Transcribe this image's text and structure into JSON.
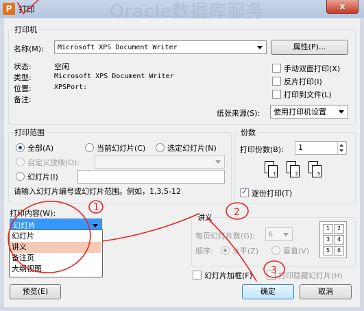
{
  "window": {
    "title": "打印",
    "app_icon_letter": "P",
    "watermark_text": "Oracle数据库服务",
    "close_glyph": "x"
  },
  "printer": {
    "legend": "打印机",
    "name_label": "名称(M):",
    "name_value": "Microsoft XPS Document Writer",
    "properties_button": "属性(P)...",
    "status_label": "状态:",
    "status_value": "空闲",
    "type_label": "类型:",
    "type_value": "Microsoft XPS Document Writer",
    "where_label": "位置:",
    "where_value": "XPSPort:",
    "comment_label": "备注:",
    "manual_duplex": "手动双面打印(X)",
    "reverse_print": "反片打印(I)",
    "print_to_file": "打印到文件(L)",
    "paper_source_label": "纸张来源(S):",
    "paper_source_value": "使用打印机设置"
  },
  "range": {
    "legend": "打印范围",
    "all": "全部(A)",
    "current_slide": "当前幻灯片(C)",
    "selected_slides": "选定幻灯片(N)",
    "custom_show": "自定义放映(O):",
    "slides": "幻灯片(I)",
    "hint": "请输入幻灯片编号或幻灯片范围。例如，1,3,5-12"
  },
  "copies": {
    "legend": "份数",
    "count_label": "打印份数(B):",
    "count_value": "1",
    "page_labels": [
      "1",
      "1",
      "2",
      "2",
      "3",
      "3"
    ],
    "collate": "逐份打印(T)"
  },
  "print_what": {
    "label": "打印内容(W):",
    "value": "幻灯片",
    "options": [
      "幻灯片",
      "讲义",
      "备注页",
      "大纲视图"
    ]
  },
  "handouts": {
    "legend": "讲义",
    "per_page_label": "每页幻灯片数(G):",
    "per_page_value": "6",
    "order_label": "顺序:",
    "horizontal": "水平(Z)",
    "vertical": "垂直(V)",
    "grid_labels": [
      "1",
      "2",
      "3",
      "4",
      "5",
      "6"
    ]
  },
  "options": {
    "frame_slides": "幻灯片加框(F)",
    "print_hidden": "打印隐藏幻灯片(H)"
  },
  "buttons": {
    "preview": "预览(E)",
    "ok": "确定",
    "cancel": "取消"
  },
  "annotations": {
    "marks": [
      "1",
      "2",
      "3"
    ],
    "color": "#e8231c"
  }
}
